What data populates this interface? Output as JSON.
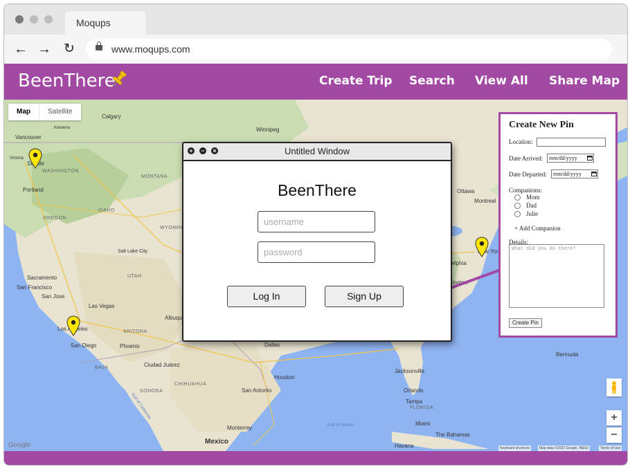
{
  "browser": {
    "tab_title": "Moqups",
    "url": "www.moqups.com",
    "traffic_light_colors": [
      "#7a7a7a",
      "#bdbdbd",
      "#bdbdbd"
    ]
  },
  "app": {
    "name": "BeenThere",
    "brand_color": "#a24aa3",
    "nav": [
      "Create Trip",
      "Search",
      "View All",
      "Share Map"
    ]
  },
  "map": {
    "type_toggle": {
      "map": "Map",
      "satellite": "Satellite"
    },
    "zoom_in": "+",
    "zoom_out": "−",
    "attribution": {
      "shortcuts": "Keyboard shortcuts",
      "data": "Map data ©2022 Google, INEGI",
      "terms": "Terms of Use"
    },
    "google_logo": "Google",
    "labels": {
      "calgary": "Calgary",
      "kelowna": "Kelowna",
      "vancouver": "Vancouver",
      "victoria": "Victoria",
      "seattle": "Seattle",
      "washington": "WASHINGTON",
      "winnipeg": "Winnipeg",
      "montana": "MONTANA",
      "portland": "Portland",
      "oregon": "OREGON",
      "idaho": "IDAHO",
      "wyoming": "WYOMING",
      "salt_lake_city": "Salt Lake City",
      "utah": "UTAH",
      "sacramento": "Sacramento",
      "san_francisco": "San Francisco",
      "san_jose": "San Jose",
      "las_vegas": "Las Vegas",
      "los_angeles": "Los Angeles",
      "san_diego": "San Diego",
      "arizona": "ARIZONA",
      "phoenix": "Phoenix",
      "albuquerque": "Albuque",
      "baja": "BAJA",
      "ciudad_juarez": "Ciudad Juárez",
      "chihuahua": "CHIHUAHUA",
      "sonora": "SONORA",
      "dallas": "Dallas",
      "houston": "Houston",
      "san_antonio": "San Antonio",
      "monterrey": "Monterrey",
      "mexico": "Mexico",
      "jacksonville": "Jacksonville",
      "orlando": "Orlando",
      "tampa": "Tampa",
      "florida": "FLORIDA",
      "miami": "Miami",
      "the_bahamas": "The Bahamas",
      "havana": "Havana",
      "bermuda": "Bermuda",
      "gulf_of_mexico": "Gulf of Mexico",
      "ottawa": "Ottawa",
      "montreal": "Montreal",
      "new_york": "New York",
      "philadelphia": "delphia",
      "washington_dc": "hington",
      "gulf_of_california": "Gulf of California"
    }
  },
  "login_window": {
    "title": "Untitled Window",
    "app_name": "BeenThere",
    "username_placeholder": "username",
    "password_placeholder": "password",
    "login_label": "Log In",
    "signup_label": "Sign Up"
  },
  "create_pin": {
    "title": "Create New Pin",
    "location_label": "Location:",
    "arrived_label": "Date Arrived:",
    "departed_label": "Date Departed:",
    "date_placeholder": "mm/dd/yyyy",
    "companions_label": "Companions:",
    "companions": [
      "Mom",
      "Dad",
      "Julie"
    ],
    "add_companion": "+ Add Companion",
    "details_label": "Details:",
    "details_placeholder": "What did you do there?",
    "submit_label": "Create Pin"
  }
}
